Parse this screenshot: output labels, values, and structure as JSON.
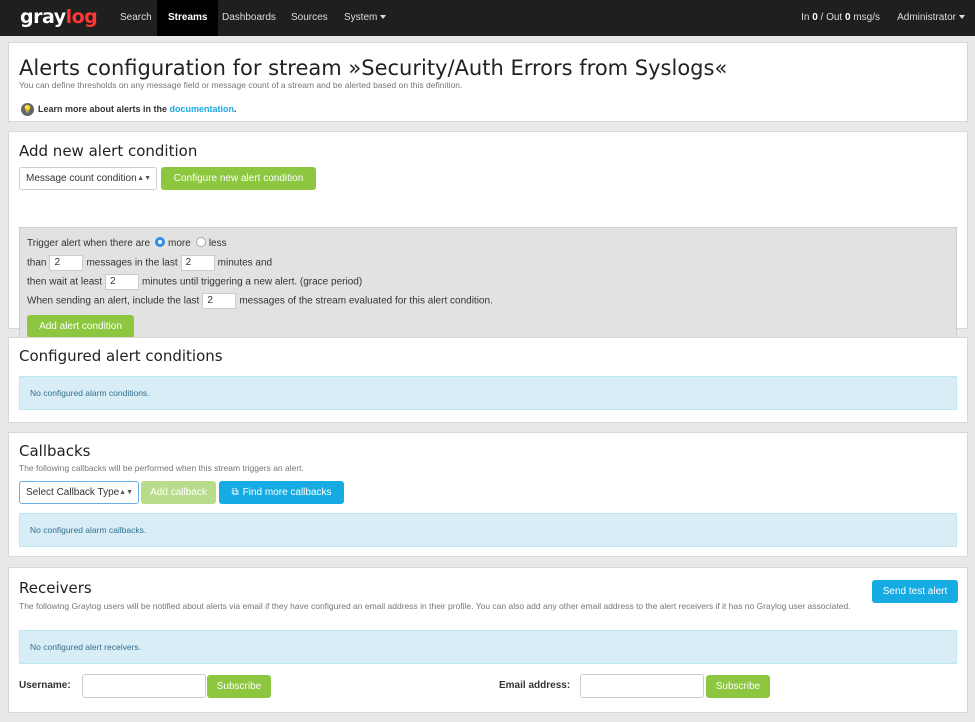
{
  "nav": {
    "logo_main": "gray",
    "logo_accent": "log",
    "items": [
      {
        "label": "Search"
      },
      {
        "label": "Streams"
      },
      {
        "label": "Dashboards"
      },
      {
        "label": "Sources"
      },
      {
        "label": "System"
      }
    ],
    "throughput": {
      "in_label": "In ",
      "in_value": "0",
      "out_label": " / Out ",
      "out_value": "0",
      "unit": " msg/s"
    },
    "user": "Administrator"
  },
  "header": {
    "title": "Alerts configuration for stream »Security/Auth Errors from Syslogs«",
    "description": "You can define thresholds on any message field or message count of a stream and be alerted based on this definition.",
    "learn_text": "Learn more about alerts in the ",
    "learn_link": "documentation",
    "learn_end": "."
  },
  "add_condition": {
    "title": "Add new alert condition",
    "condition_type": "Message count condition",
    "configure_button": "Configure new alert condition",
    "form": {
      "trigger_prefix": "Trigger alert when there are",
      "option_more": "more",
      "option_less": "less",
      "than_label": "than",
      "messages_value": "2",
      "messages_in_last": "messages in the last",
      "minutes_value": "2",
      "minutes_and": "minutes and",
      "wait_prefix": "then wait at least",
      "grace_value": "2",
      "grace_suffix": "minutes until triggering a new alert. (grace period)",
      "include_prefix": "When sending an alert, include the last",
      "include_value": "2",
      "include_suffix": "messages of the stream evaluated for this alert condition."
    },
    "add_button": "Add alert condition"
  },
  "configured": {
    "title": "Configured alert conditions",
    "empty": "No configured alarm conditions."
  },
  "callbacks": {
    "title": "Callbacks",
    "description": "The following callbacks will be performed when this stream triggers an alert.",
    "select_value": "Select Callback Type",
    "add_button": "Add callback",
    "find_button": "Find more callbacks",
    "empty": "No configured alarm callbacks."
  },
  "receivers": {
    "title": "Receivers",
    "description": "The following Graylog users will be notified about alerts via email if they have configured an email address in their profile. You can also add any other email address to the alert receivers if it has no Graylog user associated.",
    "send_test_button": "Send test alert",
    "empty": "No configured alert receivers.",
    "username_label": "Username:",
    "email_label": "Email address:",
    "subscribe_label": "Subscribe"
  },
  "colors": {
    "accent_green": "#8dc63f",
    "accent_blue": "#16ace3",
    "logo_red": "#ff3633",
    "navbar": "#1f1f1f"
  }
}
